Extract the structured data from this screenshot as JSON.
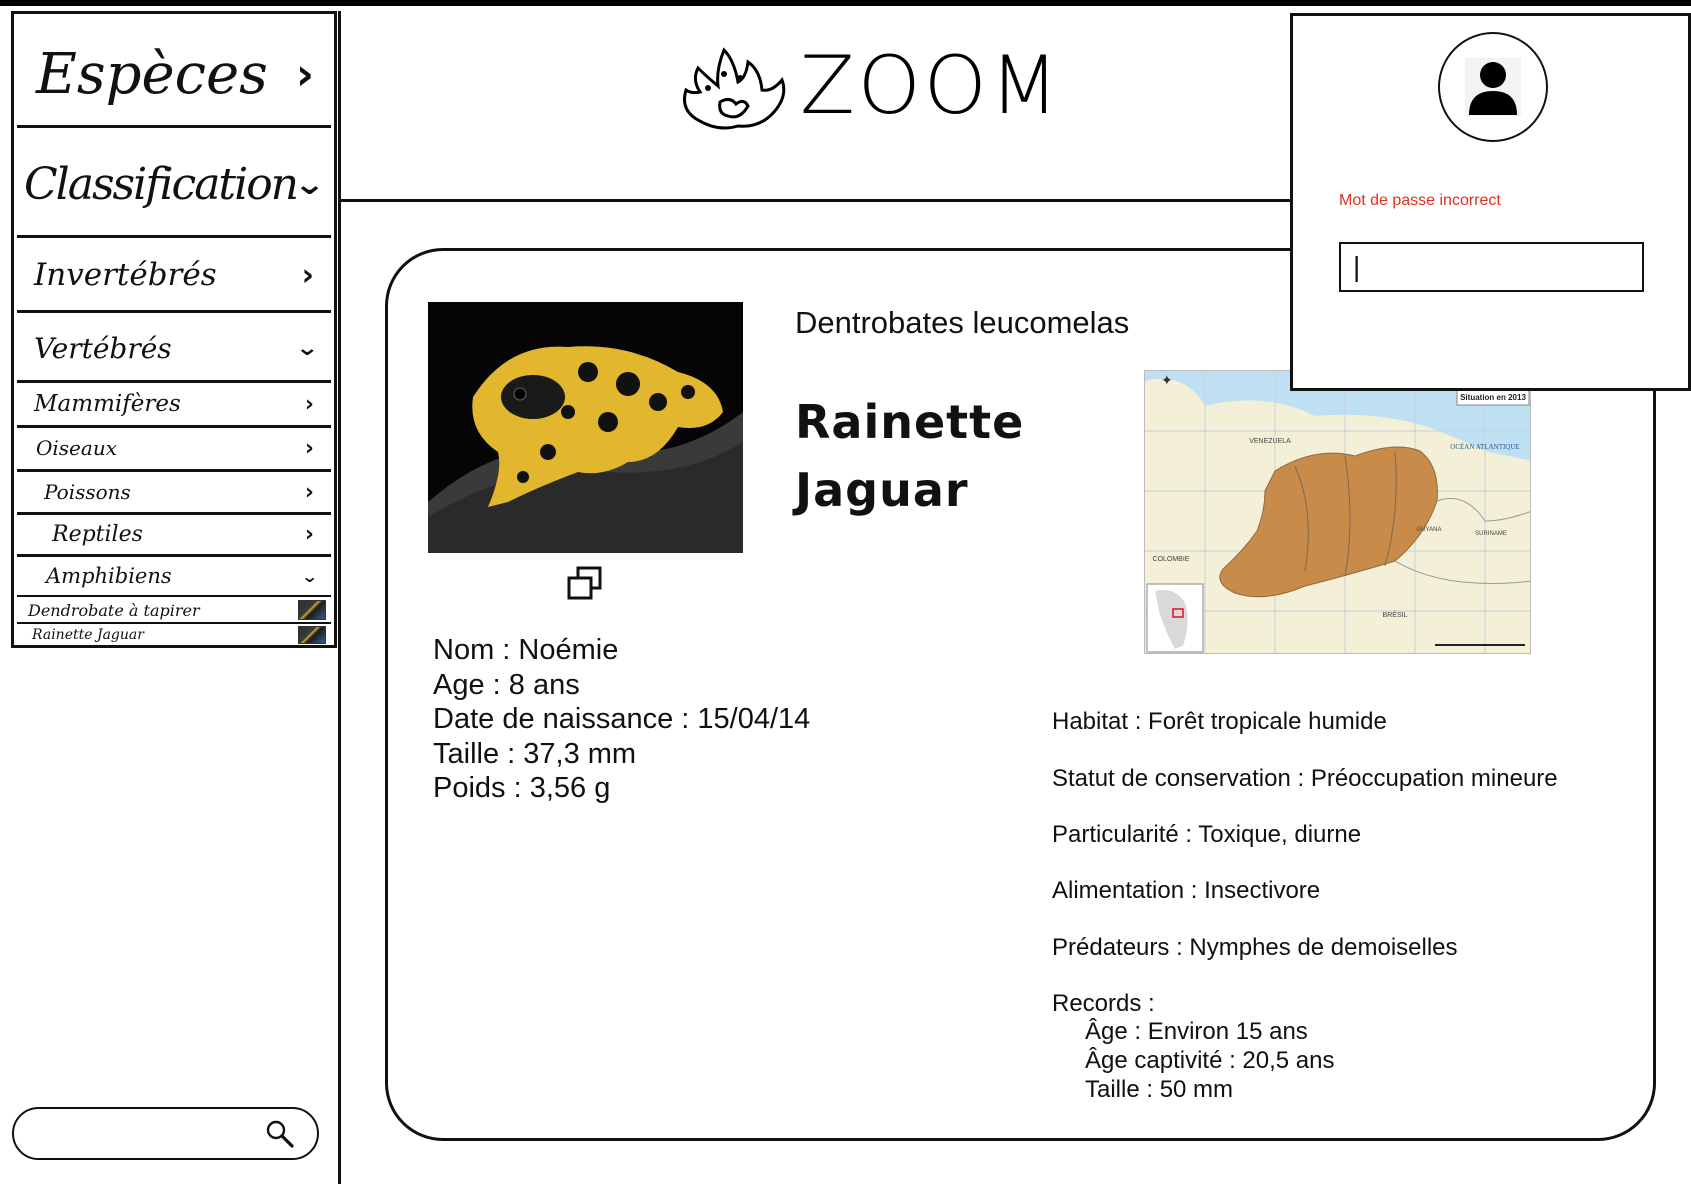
{
  "app": {
    "logo_text": "ZOOM"
  },
  "sidebar": {
    "especes": "Espèces",
    "classification": "Classification",
    "invertebres": "Invertébrés",
    "vertebres": "Vertébrés",
    "mammiferes": "Mammifères",
    "oiseaux": "Oiseaux",
    "poissons": "Poissons",
    "reptiles": "Reptiles",
    "amphibiens": "Amphibiens",
    "leaf_1": "Dendrobate à tapirer",
    "leaf_2": "Rainette Jaguar"
  },
  "search": {
    "placeholder": "",
    "value": ""
  },
  "animal": {
    "scientific_name": "Dentrobates leucomelas",
    "common_name": "Rainette Jaguar",
    "nom": "Nom : Noémie",
    "age": "Age : 8 ans",
    "naissance": "Date de naissance : 15/04/14",
    "taille": "Taille : 37,3 mm",
    "poids": "Poids : 3,56 g",
    "habitat": "Habitat : Forêt tropicale humide",
    "statut": "Statut de conservation : Préoccupation mineure",
    "particularite": "Particularité : Toxique, diurne",
    "alimentation": "Alimentation : Insectivore",
    "predateurs": "Prédateurs : Nymphes de demoiselles",
    "records_title": "Records :",
    "record_age": "Âge : Environ 15 ans",
    "record_age_captivite": "Âge captivité : 20,5 ans",
    "record_taille": "Taille : 50 mm"
  },
  "map": {
    "label_situation": "Situation en 2013",
    "label_venezuela": "VENEZUELA",
    "label_ocean": "OCÉAN ATLANTIQUE",
    "label_colombie": "COLOMBIE",
    "label_bresil": "BRÉSIL",
    "label_guyana": "GUYANA",
    "label_suriname": "SURINAME"
  },
  "login": {
    "error_message": "Mot de passe incorrect",
    "password_value": "|"
  },
  "colors": {
    "error": "#e0301e",
    "range_fill": "#c98b4a",
    "map_land": "#f4f0d8",
    "map_water": "#bfe0f2"
  },
  "icons": {
    "search": "magnifier-icon",
    "copy": "copy-icon",
    "user": "user-icon",
    "chevron_right": "chevron-right-icon",
    "chevron_down": "chevron-down-icon"
  }
}
